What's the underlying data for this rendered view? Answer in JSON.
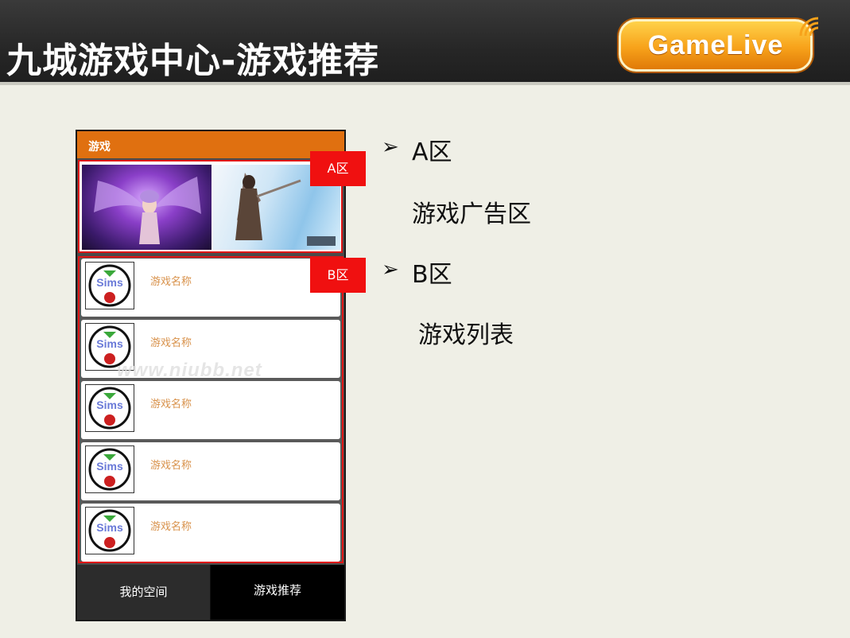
{
  "slide": {
    "title": "九城游戏中心-游戏推荐",
    "logo_text": "GameLive"
  },
  "phone": {
    "app_title": "游戏",
    "games": [
      {
        "name": "游戏名称"
      },
      {
        "name": "游戏名称"
      },
      {
        "name": "游戏名称"
      },
      {
        "name": "游戏名称"
      },
      {
        "name": "游戏名称"
      }
    ],
    "tabs": {
      "my_space": "我的空间",
      "recommend": "游戏推荐"
    }
  },
  "zone_tags": {
    "a": "A区",
    "b": "B区"
  },
  "watermark": "www.niubb.net",
  "bullets": [
    {
      "marker": "➢",
      "heading": "A区",
      "description": "游戏广告区"
    },
    {
      "marker": "➢",
      "heading": "B区",
      "description": "游戏列表"
    }
  ],
  "colors": {
    "app_bar": "#e07010",
    "zone_border": "#e01515",
    "zone_tag": "#f01010",
    "game_name": "#d8914a"
  }
}
